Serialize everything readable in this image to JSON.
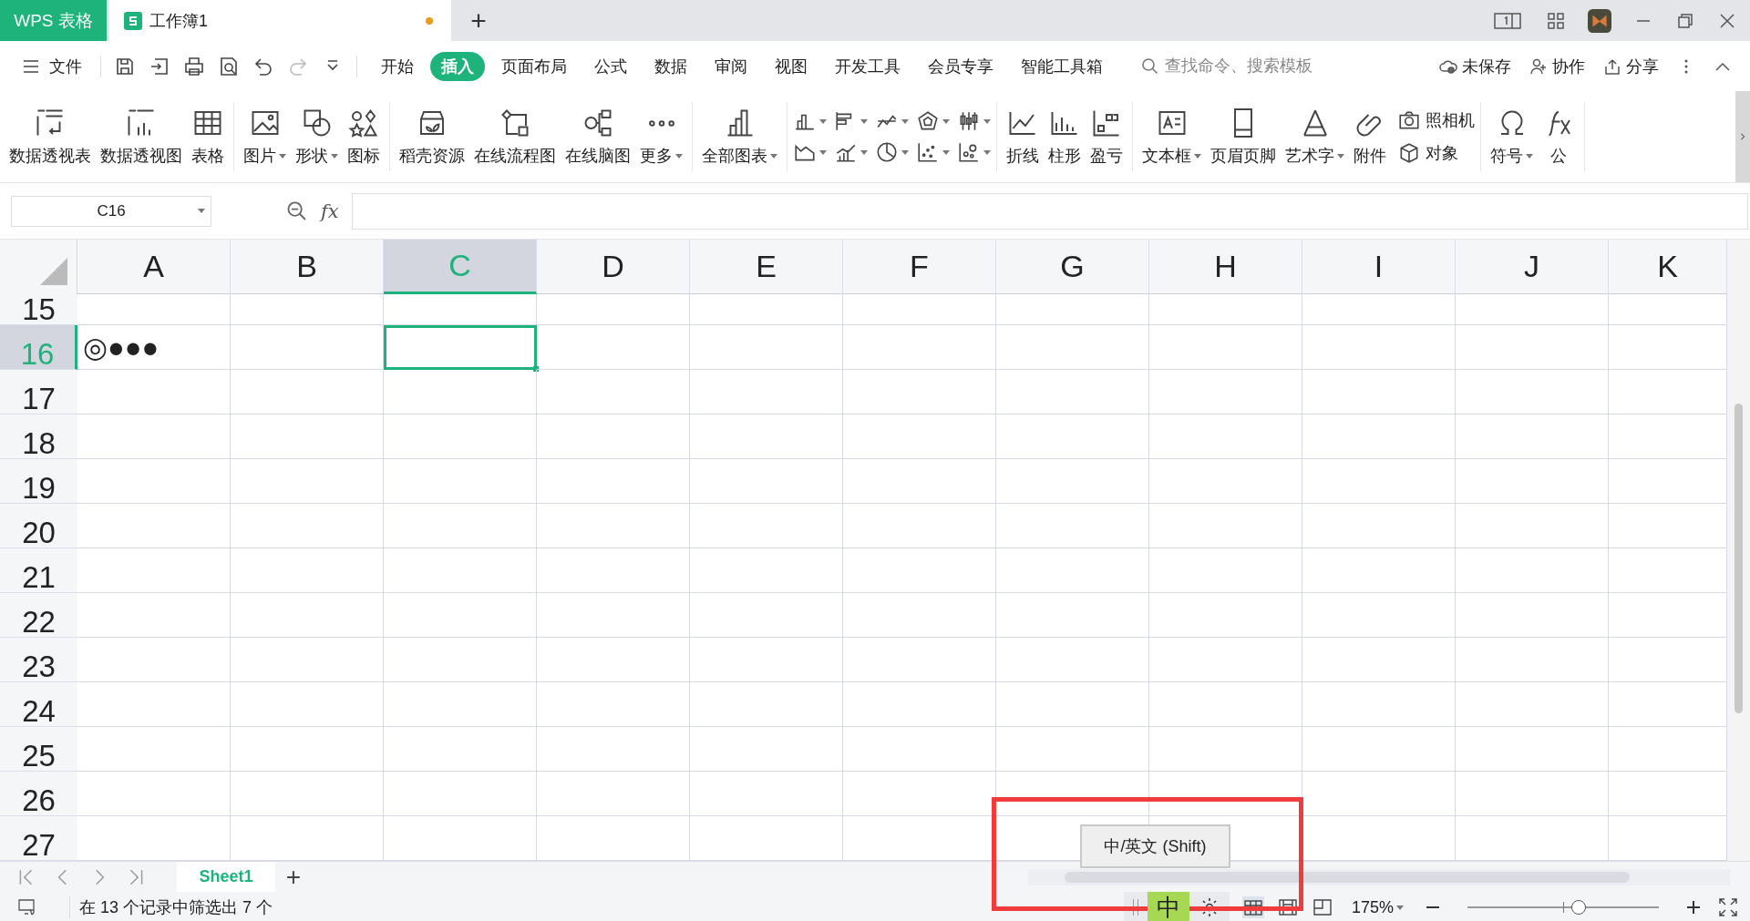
{
  "title_bar": {
    "app_tab": "WPS 表格",
    "doc_tab": {
      "title": "工作簿1",
      "unsaved": true
    },
    "new_tab": "+"
  },
  "menu_bar": {
    "file": "文件",
    "tabs": [
      {
        "label": "开始",
        "selected": false
      },
      {
        "label": "插入",
        "selected": true
      },
      {
        "label": "页面布局",
        "selected": false
      },
      {
        "label": "公式",
        "selected": false
      },
      {
        "label": "数据",
        "selected": false
      },
      {
        "label": "审阅",
        "selected": false
      },
      {
        "label": "视图",
        "selected": false
      },
      {
        "label": "开发工具",
        "selected": false
      },
      {
        "label": "会员专享",
        "selected": false
      },
      {
        "label": "智能工具箱",
        "selected": false
      }
    ],
    "search": {
      "placeholder": "查找命令、搜索模板"
    },
    "actions": [
      "未保存",
      "协作",
      "分享"
    ]
  },
  "ribbon": [
    {
      "kind": "buttons",
      "items": [
        {
          "label": "数据透视表",
          "kind": "big",
          "dropdown": false
        },
        {
          "label": "数据透视图",
          "kind": "big",
          "dropdown": false
        },
        {
          "label": "表格",
          "kind": "big",
          "dropdown": false
        }
      ]
    },
    {
      "kind": "buttons",
      "items": [
        {
          "label": "图片",
          "kind": "big",
          "dropdown": true
        },
        {
          "label": "形状",
          "kind": "big",
          "dropdown": true
        },
        {
          "label": "图标",
          "kind": "big",
          "dropdown": false
        }
      ]
    },
    {
      "kind": "buttons",
      "items": [
        {
          "label": "稻壳资源",
          "kind": "big",
          "dropdown": false
        },
        {
          "label": "在线流程图",
          "kind": "big",
          "dropdown": false
        },
        {
          "label": "在线脑图",
          "kind": "big",
          "dropdown": false
        },
        {
          "label": "更多",
          "kind": "big",
          "dropdown": true
        }
      ]
    },
    {
      "kind": "buttons",
      "items": [
        {
          "label": "全部图表",
          "kind": "big",
          "dropdown": true
        }
      ]
    },
    {
      "kind": "chart-grid"
    },
    {
      "kind": "buttons",
      "items": [
        {
          "label": "折线",
          "kind": "big",
          "dropdown": false
        },
        {
          "label": "柱形",
          "kind": "big",
          "dropdown": false
        },
        {
          "label": "盈亏",
          "kind": "big",
          "dropdown": false
        }
      ]
    },
    {
      "kind": "buttons",
      "items": [
        {
          "label": "文本框",
          "kind": "big",
          "dropdown": true
        },
        {
          "label": "页眉页脚",
          "kind": "big",
          "dropdown": false
        },
        {
          "label": "艺术字",
          "kind": "big",
          "dropdown": true
        },
        {
          "label": "附件",
          "kind": "big",
          "dropdown": false
        },
        {
          "label": "照相机",
          "kind": "small",
          "dropdown": false
        },
        {
          "label": "对象",
          "kind": "small",
          "dropdown": false
        }
      ]
    },
    {
      "kind": "buttons",
      "items": [
        {
          "label": "符号",
          "kind": "big",
          "dropdown": true
        },
        {
          "label": "公",
          "kind": "big",
          "dropdown": false
        }
      ]
    }
  ],
  "formula_bar": {
    "name_box": "C16",
    "fx": "fx"
  },
  "sheet": {
    "columns": [
      {
        "label": "A",
        "selected": false
      },
      {
        "label": "B",
        "selected": false
      },
      {
        "label": "C",
        "selected": true
      },
      {
        "label": "D",
        "selected": false
      },
      {
        "label": "E",
        "selected": false
      },
      {
        "label": "F",
        "selected": false
      },
      {
        "label": "G",
        "selected": false
      },
      {
        "label": "H",
        "selected": false
      },
      {
        "label": "I",
        "selected": false
      },
      {
        "label": "J",
        "selected": false
      },
      {
        "label": "K",
        "selected": false
      }
    ],
    "rows": [
      {
        "label": "15",
        "selected": false
      },
      {
        "label": "16",
        "selected": true,
        "values": {
          "A": "◎●●●"
        }
      },
      {
        "label": "17",
        "selected": false
      },
      {
        "label": "18",
        "selected": false
      },
      {
        "label": "19",
        "selected": false
      },
      {
        "label": "20",
        "selected": false
      },
      {
        "label": "21",
        "selected": false
      },
      {
        "label": "22",
        "selected": false
      },
      {
        "label": "23",
        "selected": false
      },
      {
        "label": "24",
        "selected": false
      },
      {
        "label": "25",
        "selected": false
      },
      {
        "label": "26",
        "selected": false
      },
      {
        "label": "27",
        "selected": false
      }
    ]
  },
  "sheet_tabs": [
    {
      "label": "Sheet1",
      "selected": true
    }
  ],
  "add_sheet": "+",
  "tooltip": "中/英文 (Shift)",
  "status_bar": {
    "message": "在 13 个记录中筛选出 7 个",
    "ime": {
      "label": "中",
      "on": true
    },
    "zoom": "175%",
    "zoom_slider": {
      "level": 0.58
    }
  }
}
